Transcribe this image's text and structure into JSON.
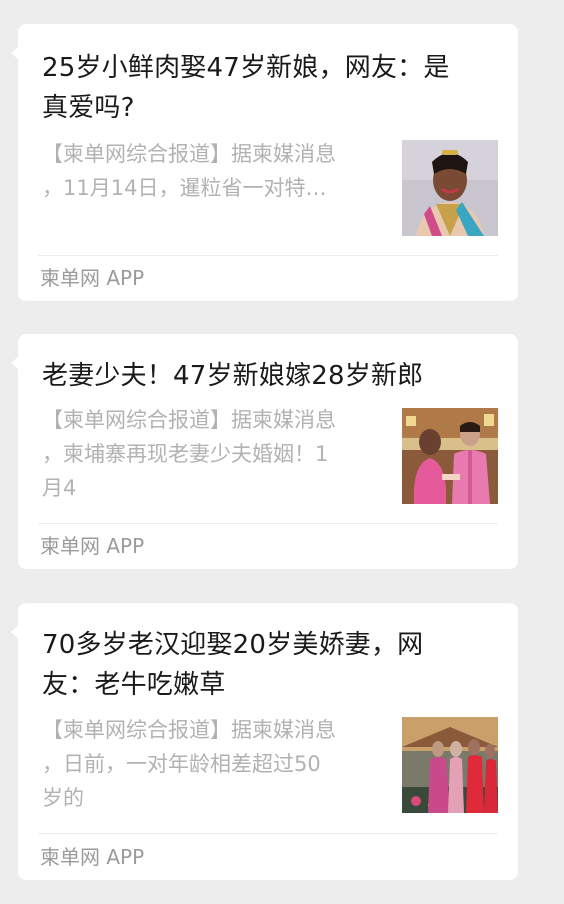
{
  "articles": [
    {
      "title": "25岁小鲜肉娶47岁新娘，网友：是\n真爱吗?",
      "summary": "【柬单网综合报道】据柬媒消息\n，11月14日，暹粒省一对特…",
      "source": "柬单网 APP",
      "thumbnail": "portrait-of-bride-in-traditional-dress"
    },
    {
      "title": "老妻少夫！47岁新娘嫁28岁新郎",
      "summary": "【柬单网综合报道】据柬媒消息\n，柬埔寨再现老妻少夫婚姻！1\n月4",
      "source": "柬单网 APP",
      "thumbnail": "couple-in-pink-wedding-attire"
    },
    {
      "title": "70多岁老汉迎娶20岁美娇妻，网\n友：老牛吃嫩草",
      "summary": "【柬单网综合报道】据柬媒消息\n，日前，一对年龄相差超过50\n岁的",
      "source": "柬单网 APP",
      "thumbnail": "wedding-ceremony-group-photo"
    }
  ],
  "colors": {
    "background": "#ededed",
    "card": "#ffffff",
    "title": "#1a1a1a",
    "summary": "#b2b2b2",
    "source": "#9b9b9b"
  }
}
